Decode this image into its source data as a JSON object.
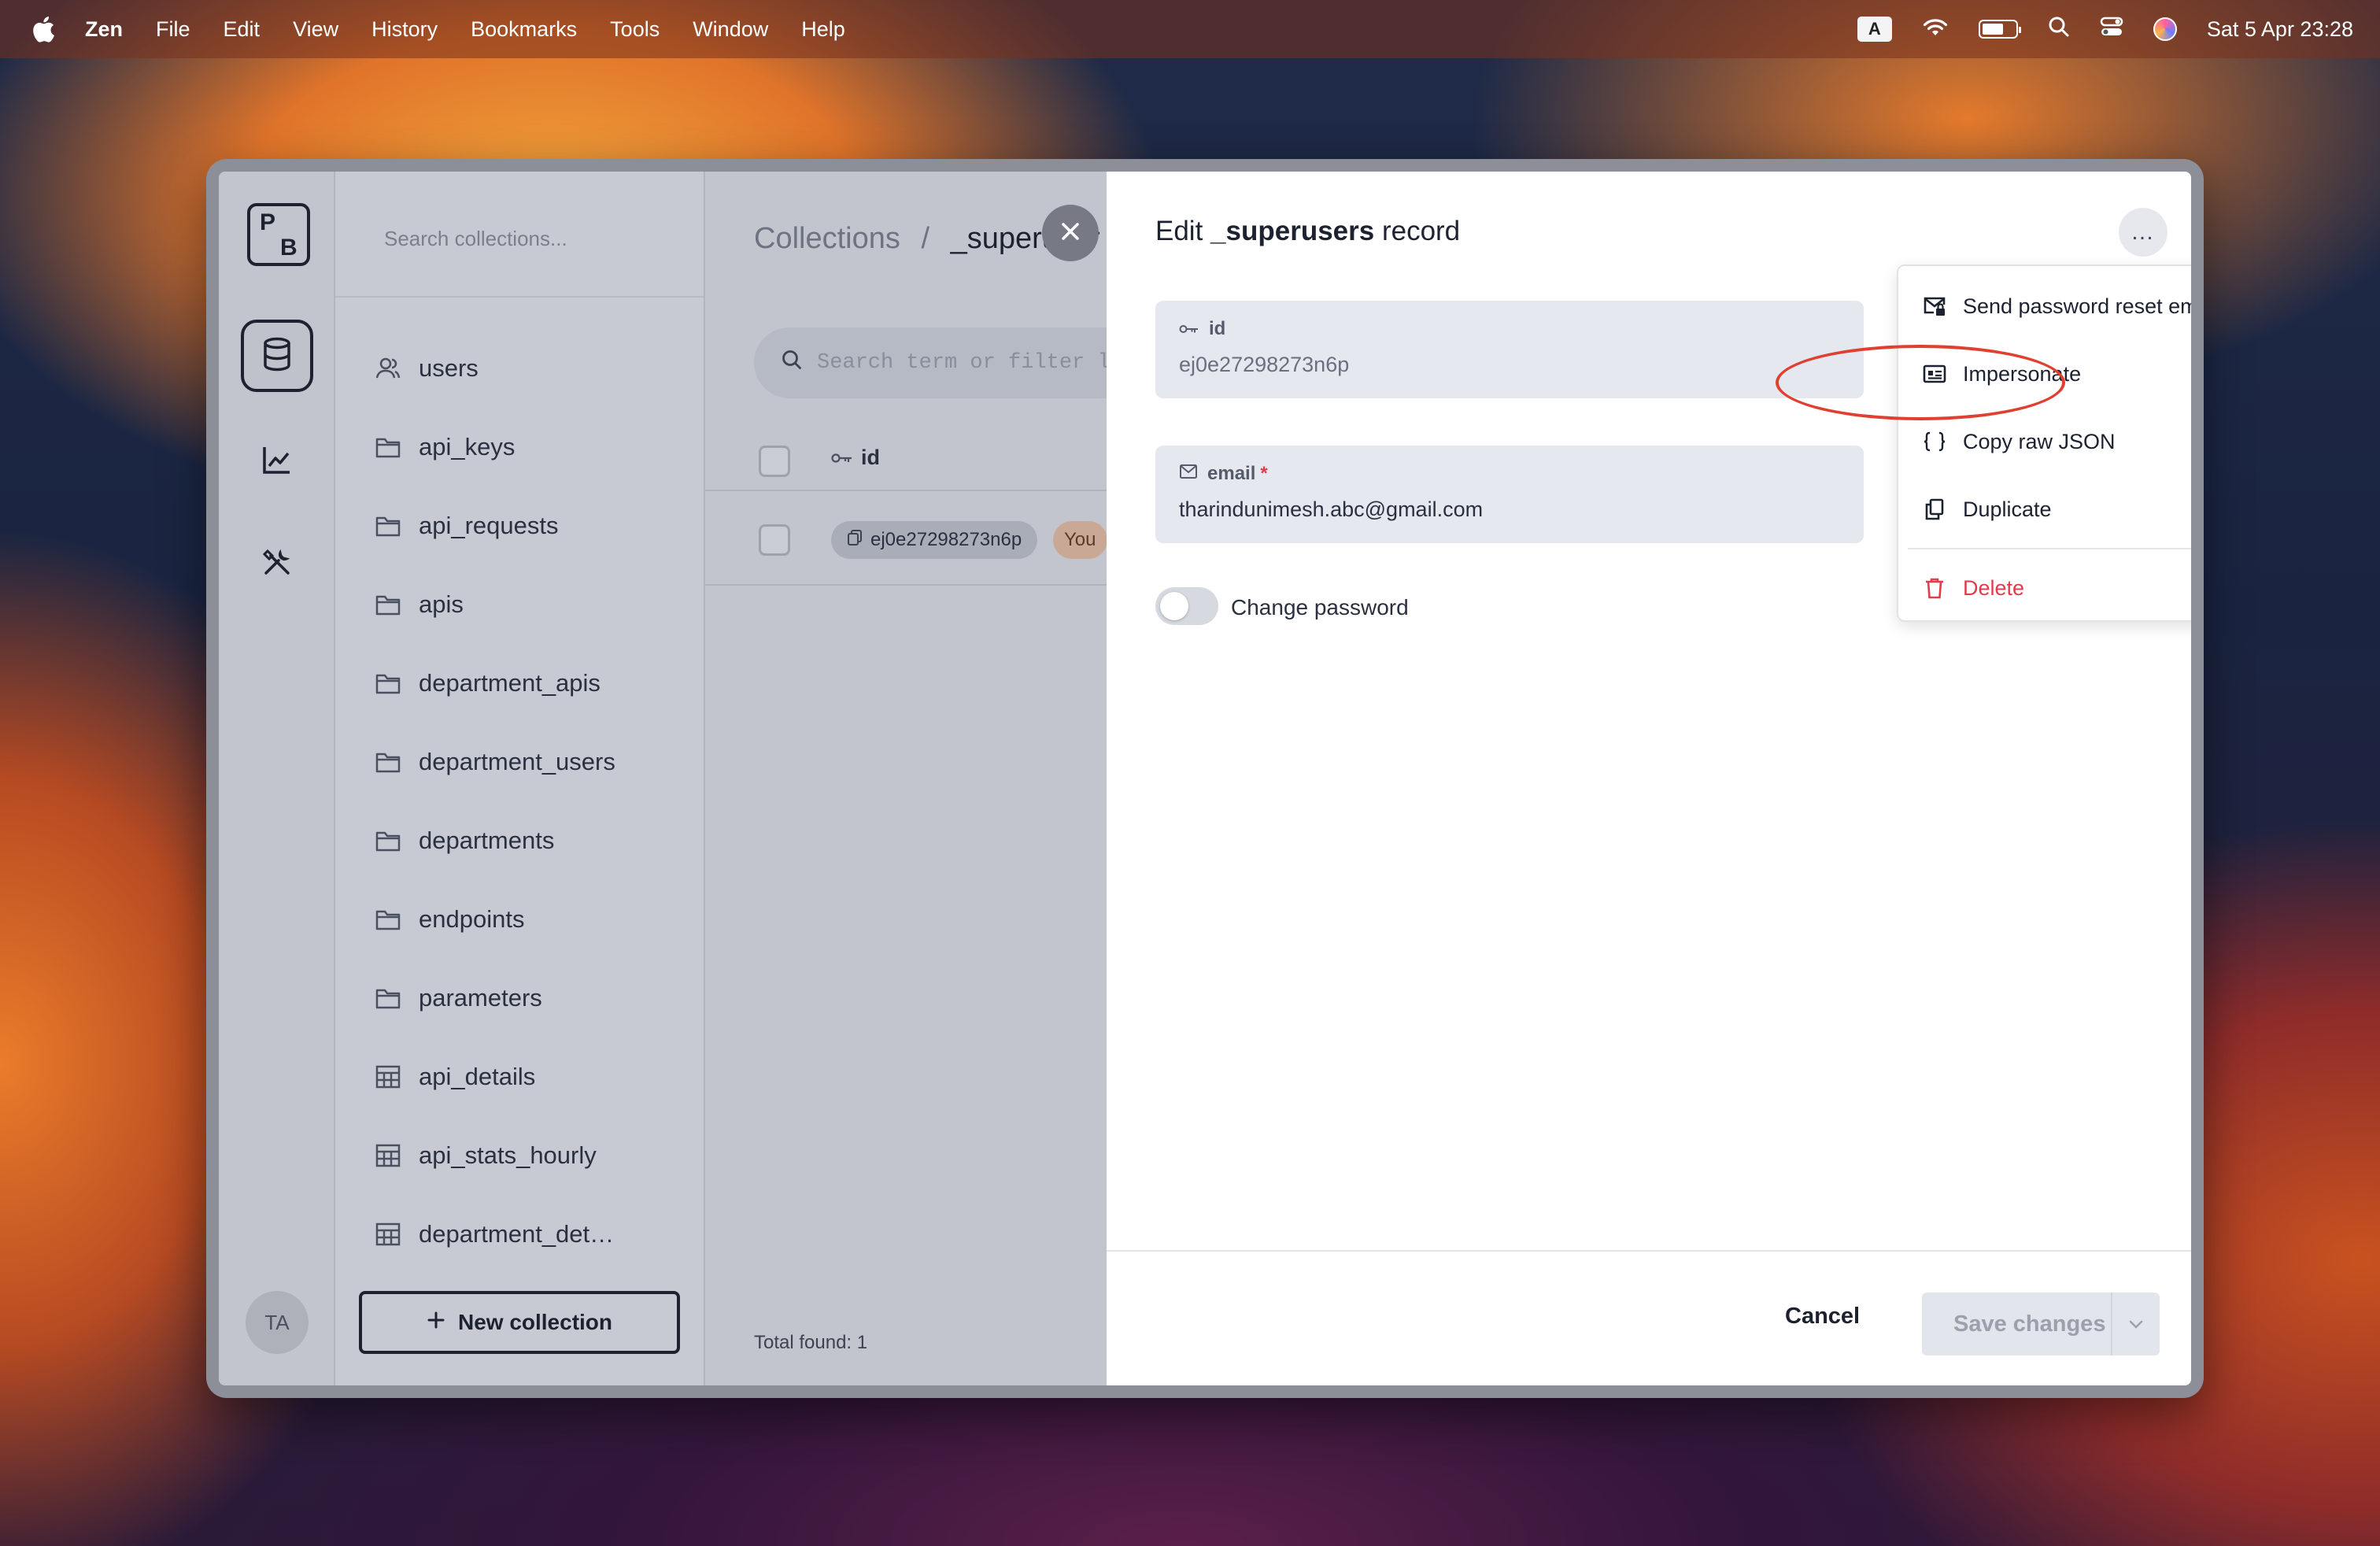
{
  "menubar": {
    "app_name": "Zen",
    "menus": [
      "File",
      "Edit",
      "View",
      "History",
      "Bookmarks",
      "Tools",
      "Window",
      "Help"
    ],
    "input_badge": "A",
    "datetime": "Sat 5 Apr  23:28"
  },
  "rail": {
    "logo_p": "P",
    "logo_b": "B",
    "avatar": "TA"
  },
  "sidebar": {
    "search_placeholder": "Search collections...",
    "collections": [
      {
        "label": "users",
        "icon": "user-icon"
      },
      {
        "label": "api_keys",
        "icon": "folder-icon"
      },
      {
        "label": "api_requests",
        "icon": "folder-icon"
      },
      {
        "label": "apis",
        "icon": "folder-icon"
      },
      {
        "label": "department_apis",
        "icon": "folder-icon"
      },
      {
        "label": "department_users",
        "icon": "folder-icon"
      },
      {
        "label": "departments",
        "icon": "folder-icon"
      },
      {
        "label": "endpoints",
        "icon": "folder-icon"
      },
      {
        "label": "parameters",
        "icon": "folder-icon"
      },
      {
        "label": "api_details",
        "icon": "table-icon"
      },
      {
        "label": "api_stats_hourly",
        "icon": "table-icon"
      },
      {
        "label": "department_det…",
        "icon": "table-icon"
      }
    ],
    "new_collection_label": "New collection"
  },
  "middle": {
    "breadcrumb_root": "Collections",
    "breadcrumb_sep": "/",
    "breadcrumb_current": "_superuser",
    "search_placeholder": "Search term or filter li",
    "column_id": "id",
    "row_id": "ej0e27298273n6p",
    "row_badge": "You",
    "total_label": "Total found:  1"
  },
  "panel": {
    "title_prefix": "Edit ",
    "title_collection": "_superusers",
    "title_suffix": " record",
    "more_label": "…",
    "id_label": "id",
    "id_value": "ej0e27298273n6p",
    "email_label": "email",
    "email_required": "*",
    "email_value": "tharindunimesh.abc@gmail.com",
    "change_password_label": "Change password",
    "cancel_label": "Cancel",
    "save_label": "Save changes"
  },
  "dropdown": {
    "items": [
      {
        "label": "Send password reset email",
        "icon": "mail-lock-icon"
      },
      {
        "label": "Impersonate",
        "icon": "id-card-icon"
      },
      {
        "label": "Copy raw JSON",
        "icon": "braces-icon"
      },
      {
        "label": "Duplicate",
        "icon": "copy-icon"
      },
      {
        "label": "Delete",
        "icon": "trash-icon"
      }
    ]
  },
  "colors": {
    "danger": "#e03c4b",
    "annotation_ring": "#e0402f",
    "dark": "#1d2230"
  }
}
